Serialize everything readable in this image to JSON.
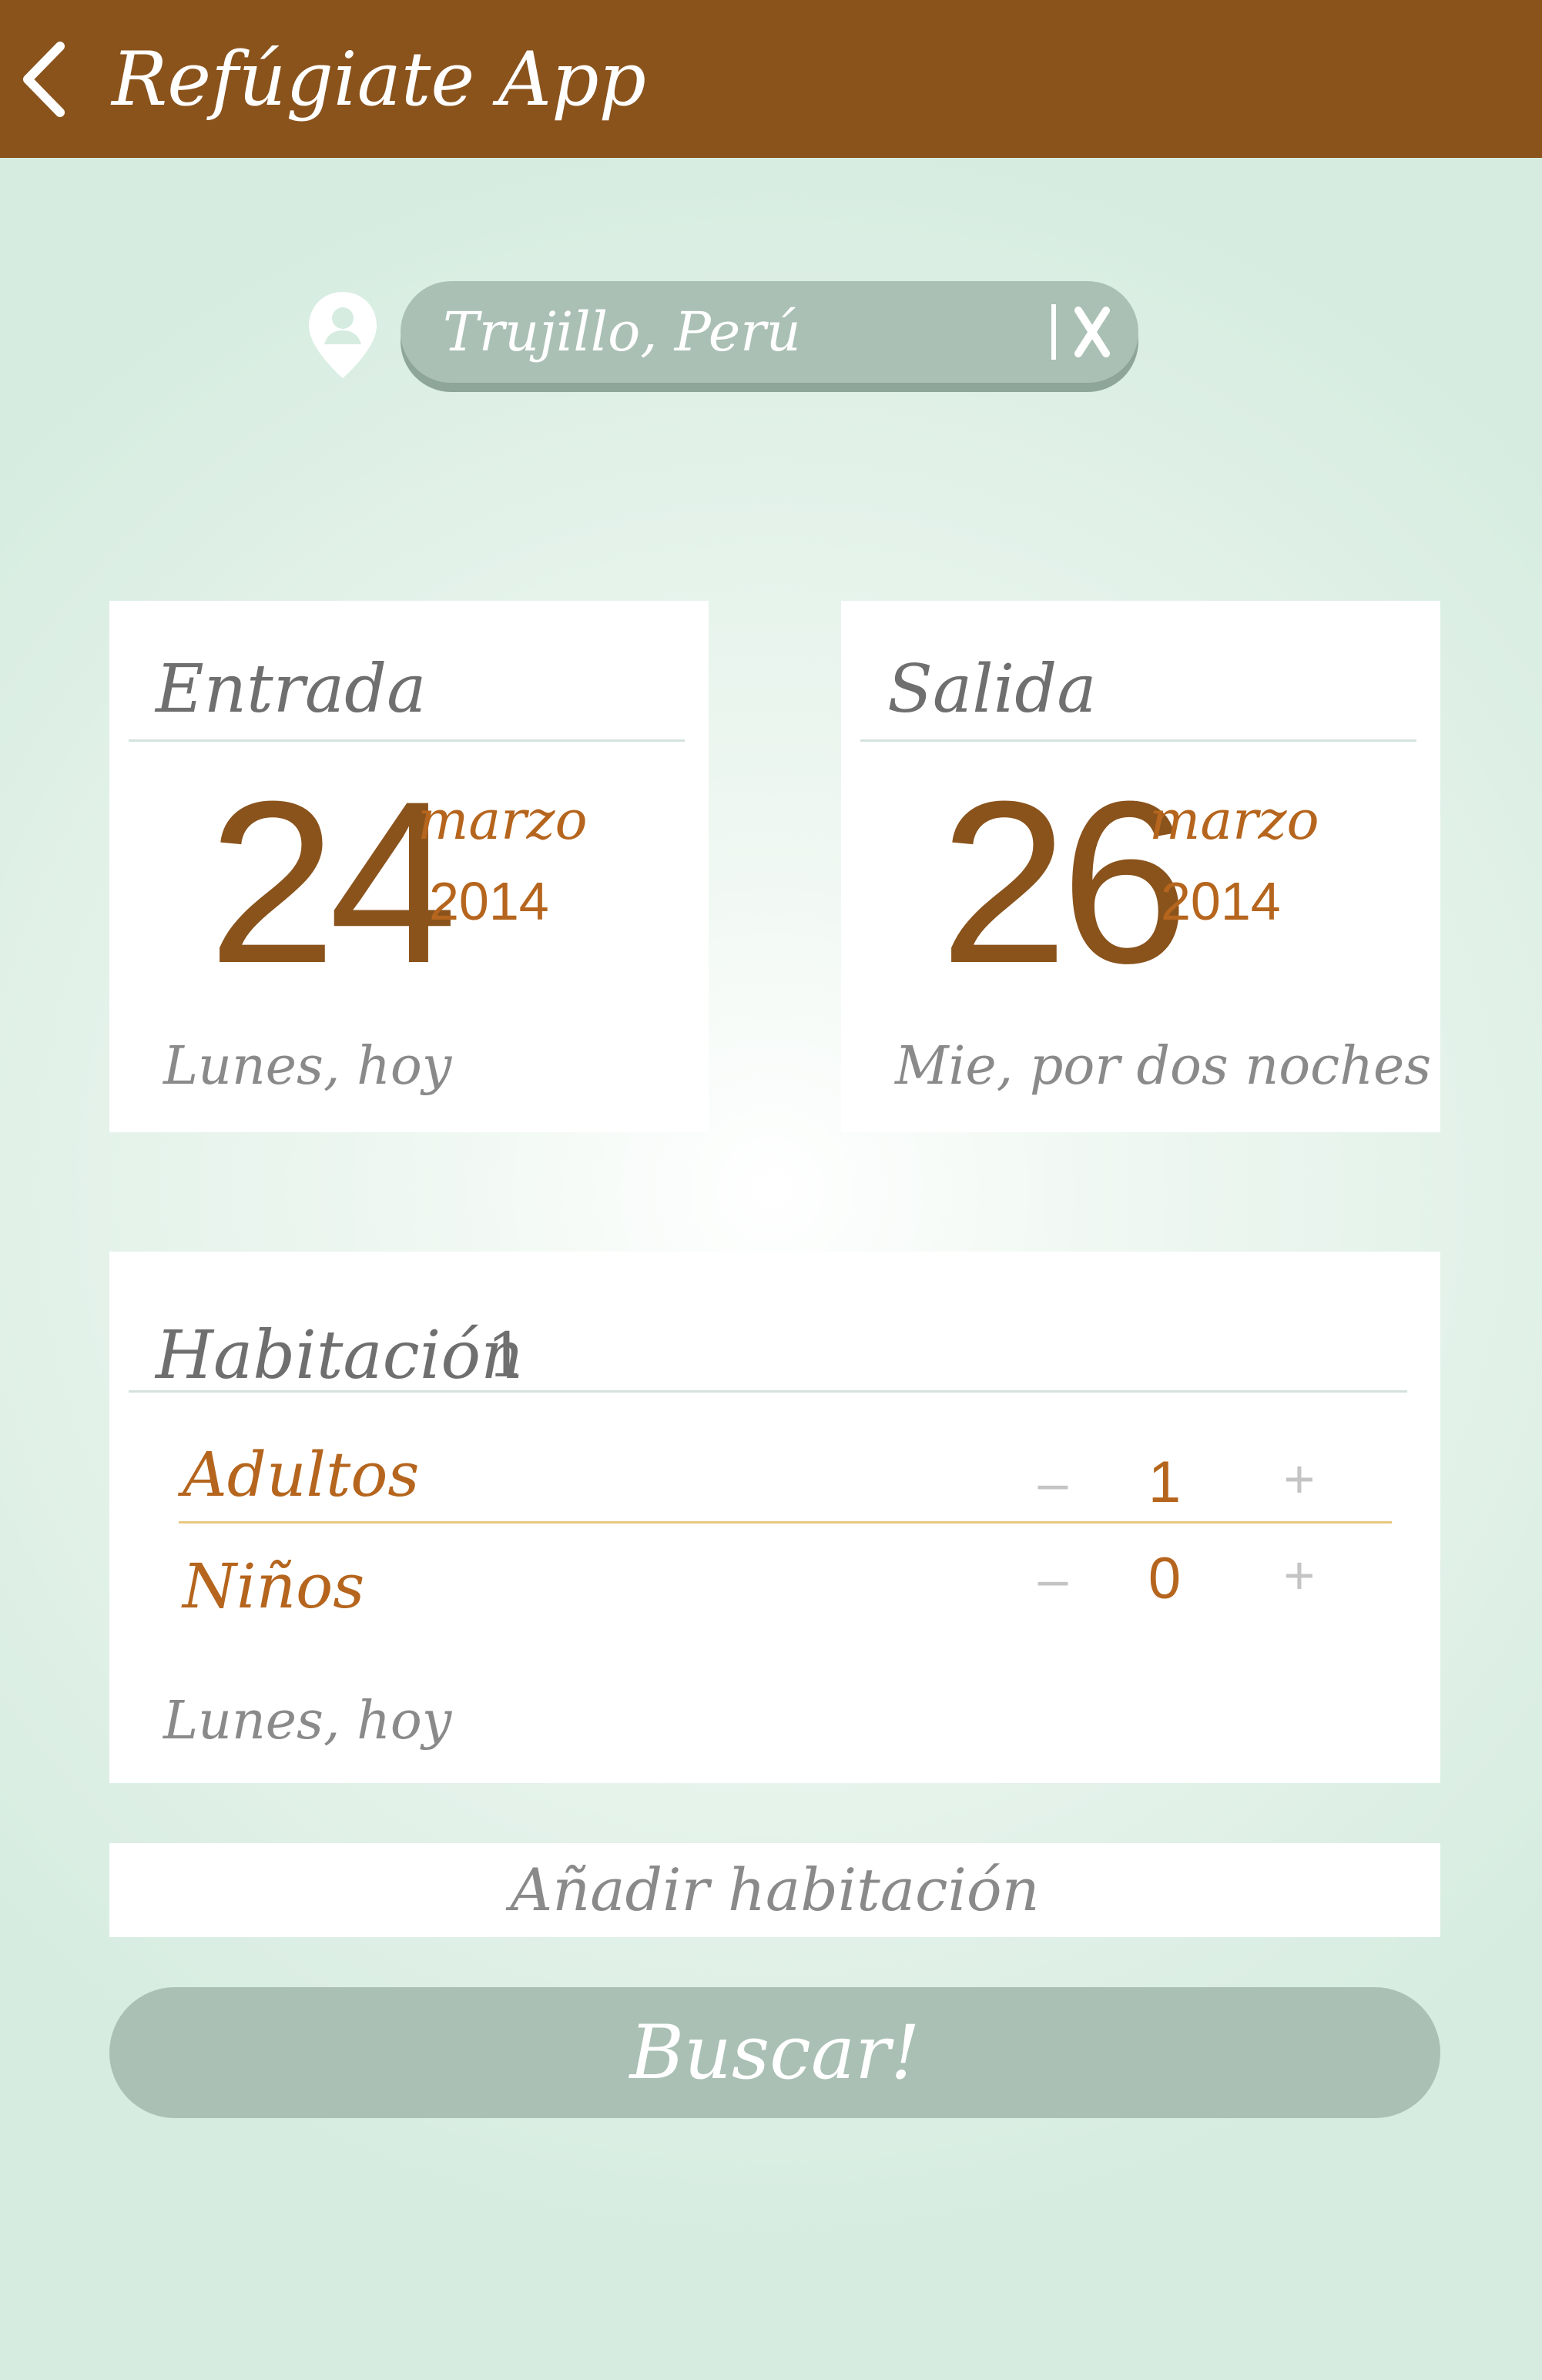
{
  "header": {
    "title": "Refúgiate App",
    "back_icon": "chevron-left-icon"
  },
  "location": {
    "icon": "map-pin-user-icon",
    "value": "Trujillo, Perú",
    "clear_icon": "clear-x-icon"
  },
  "check_in": {
    "title": "Entrada",
    "day": "24",
    "month": "marzo",
    "year": "2014",
    "note": "Lunes, hoy"
  },
  "check_out": {
    "title": "Salida",
    "day": "26",
    "month": "marzo",
    "year": "2014",
    "note": "Mie, por dos noches"
  },
  "room": {
    "title": "Habitación",
    "number": "1",
    "adults": {
      "label": "Adultos",
      "count": "1",
      "minus": "–",
      "plus": "+"
    },
    "children": {
      "label": "Niños",
      "count": "0",
      "minus": "–",
      "plus": "+"
    },
    "note": "Lunes, hoy"
  },
  "actions": {
    "add_room": "Añadir habitación",
    "search": "Buscar!"
  },
  "colors": {
    "header": "#8a531c",
    "accent": "#b5651d",
    "date": "#8a531c",
    "pill": "#aac0b4",
    "text_gray": "#6f6f6f"
  }
}
